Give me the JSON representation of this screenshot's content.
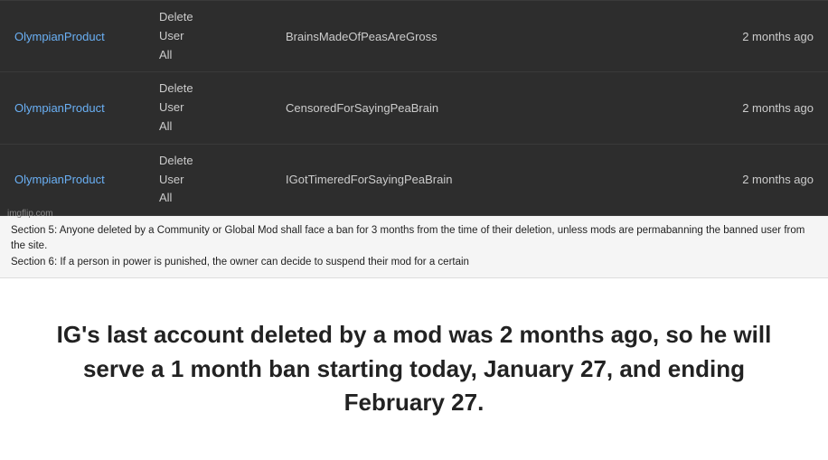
{
  "rows": [
    {
      "user": "OlympianProduct",
      "action_lines": [
        "Delete",
        "User",
        "All"
      ],
      "target": "BrainsMadeOfPeasAreGross",
      "time": "2 months ago"
    },
    {
      "user": "OlympianProduct",
      "action_lines": [
        "Delete",
        "User",
        "All"
      ],
      "target": "CensoredForSayingPeaBrain",
      "time": "2 months ago"
    },
    {
      "user": "OlympianProduct",
      "action_lines": [
        "Delete",
        "User",
        "All"
      ],
      "target": "IGotTimeredForSayingPeaBrain",
      "time": "2 months ago"
    }
  ],
  "watermark": "imgflip.com",
  "rules": {
    "section5": "Section 5: Anyone deleted by a Community or Global Mod shall face a ban for 3 months from the time of their deletion, unless mods are permabanning the banned user from the site.",
    "section6_partial": "Section 6: If a person in power is punished, the owner can decide to suspend their mod for a certain"
  },
  "statement": "IG's last account deleted by a mod was 2 months ago, so he will serve a 1 month ban starting today, January 27, and ending February 27."
}
